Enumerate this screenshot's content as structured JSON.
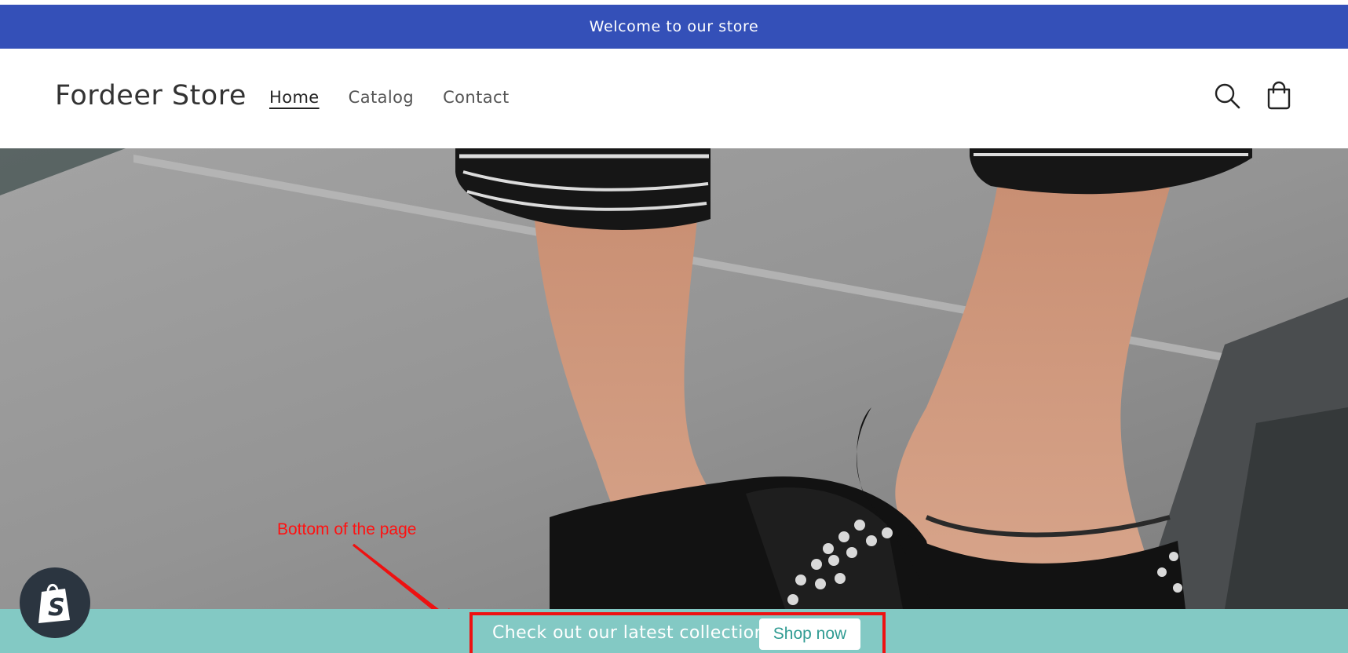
{
  "announcement": {
    "text": "Welcome to our store"
  },
  "header": {
    "store_name": "Fordeer Store",
    "nav": [
      {
        "label": "Home",
        "active": true
      },
      {
        "label": "Catalog",
        "active": false
      },
      {
        "label": "Contact",
        "active": false
      }
    ],
    "icons": [
      "search-icon",
      "cart-icon"
    ]
  },
  "annotation": {
    "text": "Bottom of the page",
    "color": "#ff1111"
  },
  "promo_bar": {
    "text": "Check out our latest collection",
    "button_label": "Shop now",
    "background": "#83c9c4",
    "highlight_color": "#ee1111"
  },
  "colors": {
    "announcement_bg": "#3450b8",
    "badge_bg": "#2b3540"
  }
}
